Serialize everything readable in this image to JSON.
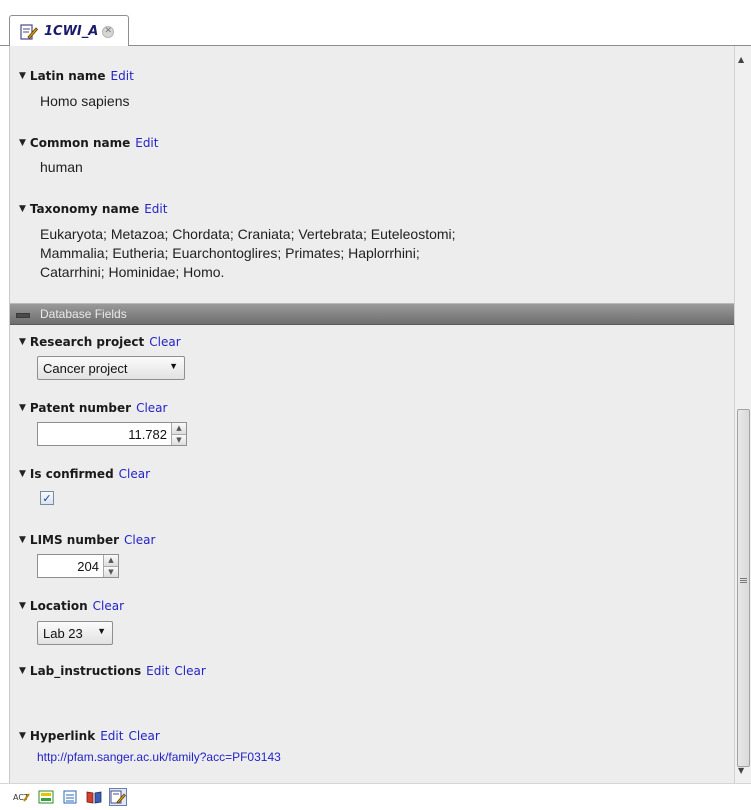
{
  "tab": {
    "title": "1CWI_A"
  },
  "fields": {
    "latin_name": {
      "label": "Latin name",
      "edit": "Edit",
      "value": "Homo sapiens"
    },
    "common_name": {
      "label": "Common name",
      "edit": "Edit",
      "value": "human"
    },
    "taxonomy_name": {
      "label": "Taxonomy name",
      "edit": "Edit",
      "lines": [
        "Eukaryota; Metazoa; Chordata; Craniata; Vertebrata; Euteleostomi;",
        "Mammalia; Eutheria; Euarchontoglires; Primates; Haplorrhini;",
        "Catarrhini; Hominidae; Homo."
      ]
    }
  },
  "database_section": {
    "title": "Database Fields"
  },
  "db_fields": {
    "research_project": {
      "label": "Research project",
      "clear": "Clear",
      "value": "Cancer project"
    },
    "patent_number": {
      "label": "Patent number",
      "clear": "Clear",
      "value": "11.782"
    },
    "is_confirmed": {
      "label": "Is confirmed",
      "clear": "Clear",
      "checked": true
    },
    "lims_number": {
      "label": "LIMS number",
      "clear": "Clear",
      "value": "204"
    },
    "location": {
      "label": "Location",
      "clear": "Clear",
      "value": "Lab 23"
    },
    "lab_instructions": {
      "label": "Lab_instructions",
      "edit": "Edit",
      "clear": "Clear"
    },
    "hyperlink": {
      "label": "Hyperlink",
      "edit": "Edit",
      "clear": "Clear",
      "value": "http://pfam.sanger.ac.uk/family?acc=PF03143"
    }
  },
  "colors": {
    "link": "#2323c8",
    "panel_bg": "#ededed",
    "section_bar": "#6e6e6e"
  },
  "toolbar": {
    "icons": [
      "text-view-icon",
      "graphical-view-icon",
      "table-view-icon",
      "book-view-icon",
      "element-info-icon"
    ]
  }
}
